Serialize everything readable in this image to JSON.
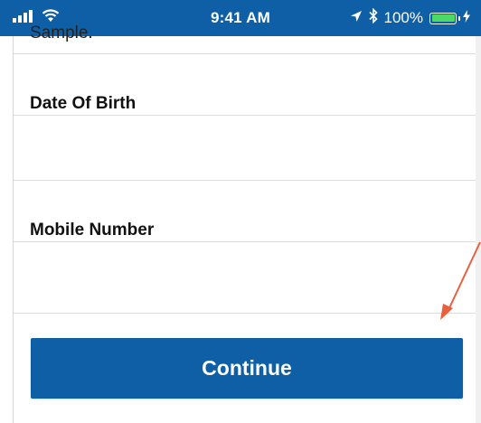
{
  "status_bar": {
    "time": "9:41 AM",
    "battery_percent": "100%",
    "battery_level": 1.0
  },
  "form": {
    "cut_off_value": "Sample.",
    "fields": [
      {
        "label": "Date Of Birth",
        "value": ""
      },
      {
        "label": "Mobile Number",
        "value": ""
      }
    ],
    "continue_label": "Continue"
  },
  "colors": {
    "primary": "#0f5fa6",
    "annotation_arrow": "#e8603c",
    "battery": "#4cd964"
  },
  "icons": [
    "signal-icon",
    "wifi-icon",
    "location-icon",
    "bluetooth-icon",
    "battery-icon",
    "charging-icon",
    "arrow-annotation-icon"
  ]
}
